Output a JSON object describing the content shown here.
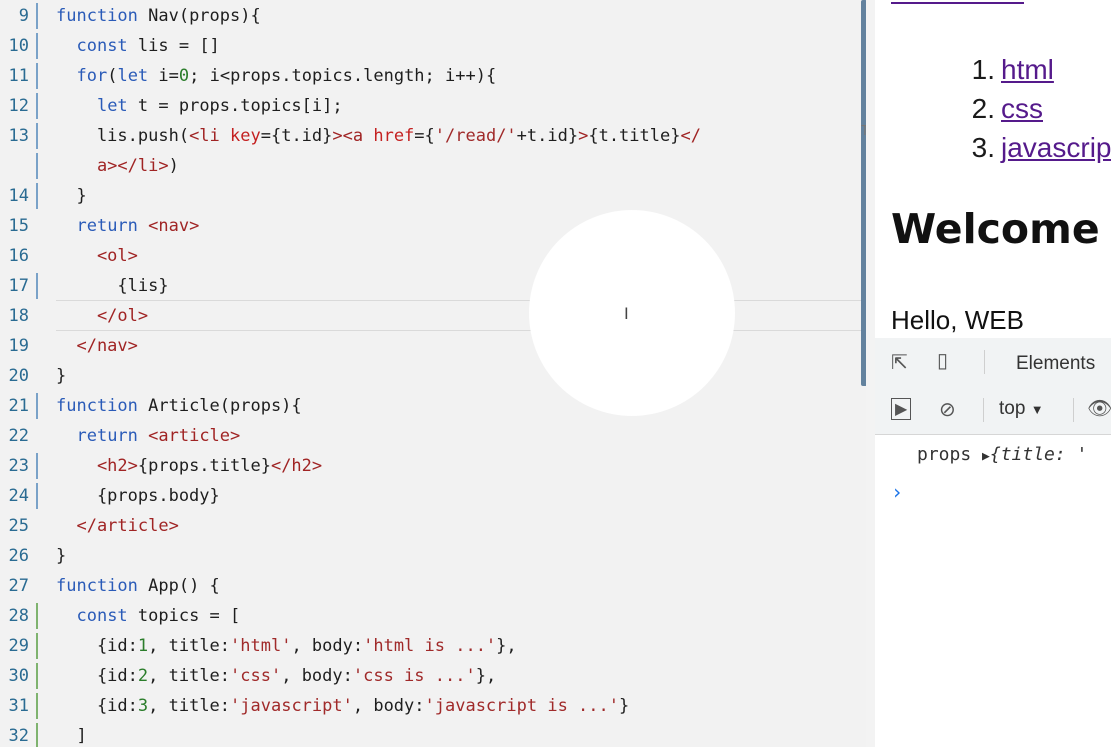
{
  "editor": {
    "lines": [
      {
        "n": "9",
        "mark": "blue",
        "segs": [
          [
            "k",
            "function "
          ],
          [
            "v",
            "Nav(props){"
          ]
        ]
      },
      {
        "n": "10",
        "mark": "blue",
        "segs": [
          [
            "v",
            "  "
          ],
          [
            "k",
            "const "
          ],
          [
            "v",
            "lis = []"
          ]
        ]
      },
      {
        "n": "11",
        "mark": "blue",
        "segs": [
          [
            "v",
            "  "
          ],
          [
            "k",
            "for"
          ],
          [
            "v",
            "("
          ],
          [
            "k",
            "let "
          ],
          [
            "v",
            "i="
          ],
          [
            "n",
            "0"
          ],
          [
            "v",
            "; i<props.topics.length; i++){"
          ]
        ]
      },
      {
        "n": "12",
        "mark": "blue",
        "segs": [
          [
            "v",
            "    "
          ],
          [
            "k",
            "let "
          ],
          [
            "v",
            "t = props.topics[i];"
          ]
        ]
      },
      {
        "n": "13",
        "mark": "blue",
        "segs": [
          [
            "v",
            "    lis.push("
          ],
          [
            "t",
            "<li "
          ],
          [
            "a",
            "key"
          ],
          [
            "v",
            "={t.id}"
          ],
          [
            "t",
            "><a "
          ],
          [
            "a",
            "href"
          ],
          [
            "v",
            "={"
          ],
          [
            "s",
            "'/read/'"
          ],
          [
            "v",
            "+t.id}"
          ],
          [
            "t",
            ">"
          ],
          [
            "v",
            "{t.title}"
          ],
          [
            "t",
            "</"
          ]
        ]
      },
      {
        "n": "",
        "mark": "blue",
        "segs": [
          [
            "t",
            "    a></li>"
          ],
          [
            "v",
            ")"
          ]
        ]
      },
      {
        "n": "14",
        "mark": "blue",
        "segs": [
          [
            "v",
            "  }"
          ]
        ]
      },
      {
        "n": "15",
        "mark": "",
        "segs": [
          [
            "v",
            "  "
          ],
          [
            "k",
            "return "
          ],
          [
            "t",
            "<nav>"
          ]
        ]
      },
      {
        "n": "16",
        "mark": "",
        "segs": [
          [
            "t",
            "    <ol>"
          ]
        ]
      },
      {
        "n": "17",
        "mark": "blue",
        "segs": [
          [
            "v",
            "      {lis}"
          ]
        ]
      },
      {
        "n": "18",
        "mark": "",
        "segs": [
          [
            "t",
            "    </ol"
          ],
          [
            "t",
            ">"
          ]
        ]
      },
      {
        "n": "19",
        "mark": "",
        "segs": [
          [
            "t",
            "  </nav>"
          ]
        ]
      },
      {
        "n": "20",
        "mark": "",
        "segs": [
          [
            "v",
            "}"
          ]
        ]
      },
      {
        "n": "21",
        "mark": "blue",
        "segs": [
          [
            "k",
            "function "
          ],
          [
            "v",
            "Article(props){"
          ]
        ]
      },
      {
        "n": "22",
        "mark": "",
        "segs": [
          [
            "v",
            "  "
          ],
          [
            "k",
            "return "
          ],
          [
            "t",
            "<article>"
          ]
        ]
      },
      {
        "n": "23",
        "mark": "blue",
        "segs": [
          [
            "t",
            "    <h2>"
          ],
          [
            "v",
            "{props.title}"
          ],
          [
            "t",
            "</h2>"
          ]
        ]
      },
      {
        "n": "24",
        "mark": "blue",
        "segs": [
          [
            "v",
            "    {props.body}"
          ]
        ]
      },
      {
        "n": "25",
        "mark": "",
        "segs": [
          [
            "t",
            "  </article>"
          ]
        ]
      },
      {
        "n": "26",
        "mark": "",
        "segs": [
          [
            "v",
            "}"
          ]
        ]
      },
      {
        "n": "27",
        "mark": "",
        "segs": [
          [
            "k",
            "function "
          ],
          [
            "v",
            "App() {"
          ]
        ]
      },
      {
        "n": "28",
        "mark": "green",
        "segs": [
          [
            "v",
            "  "
          ],
          [
            "k",
            "const "
          ],
          [
            "v",
            "topics = ["
          ]
        ]
      },
      {
        "n": "29",
        "mark": "green",
        "segs": [
          [
            "v",
            "    {id:"
          ],
          [
            "n",
            "1"
          ],
          [
            "v",
            ", title:"
          ],
          [
            "s",
            "'html'"
          ],
          [
            "v",
            ", body:"
          ],
          [
            "s",
            "'html is ...'"
          ],
          [
            "v",
            "},"
          ]
        ]
      },
      {
        "n": "30",
        "mark": "green",
        "segs": [
          [
            "v",
            "    {id:"
          ],
          [
            "n",
            "2"
          ],
          [
            "v",
            ", title:"
          ],
          [
            "s",
            "'css'"
          ],
          [
            "v",
            ", body:"
          ],
          [
            "s",
            "'css is ...'"
          ],
          [
            "v",
            "},"
          ]
        ]
      },
      {
        "n": "31",
        "mark": "green",
        "segs": [
          [
            "v",
            "    {id:"
          ],
          [
            "n",
            "3"
          ],
          [
            "v",
            ", title:"
          ],
          [
            "s",
            "'javascript'"
          ],
          [
            "v",
            ", body:"
          ],
          [
            "s",
            "'javascript is ...'"
          ],
          [
            "v",
            "}"
          ]
        ]
      },
      {
        "n": "32",
        "mark": "green",
        "segs": [
          [
            "v",
            "  ]"
          ]
        ]
      }
    ],
    "minimap_glyph": "T",
    "cursor_glyph": "I"
  },
  "preview": {
    "topics": [
      {
        "num": "1.",
        "title": "html"
      },
      {
        "num": "2.",
        "title": "css"
      },
      {
        "num": "3.",
        "title": "javascript"
      }
    ],
    "article_title": "Welcome",
    "article_body": "Hello, WEB"
  },
  "devtools": {
    "tab_elements": "Elements",
    "context": "top",
    "context_arrow": "▼",
    "inspect_icon": "⇱",
    "device_icon": "▯",
    "sidebar_icon": "▶",
    "clear_icon": "⊘",
    "eye_icon": "👁",
    "console_label": "props",
    "console_arrow": "▶",
    "console_value": "{title: '",
    "prompt": "›"
  },
  "colors": {
    "keyword": "#2a5bb8",
    "tag": "#a02424",
    "string": "#a02a2a",
    "number": "#2b7d2b",
    "link_visited": "#551a8b",
    "gutter_number": "#2a6b92"
  }
}
